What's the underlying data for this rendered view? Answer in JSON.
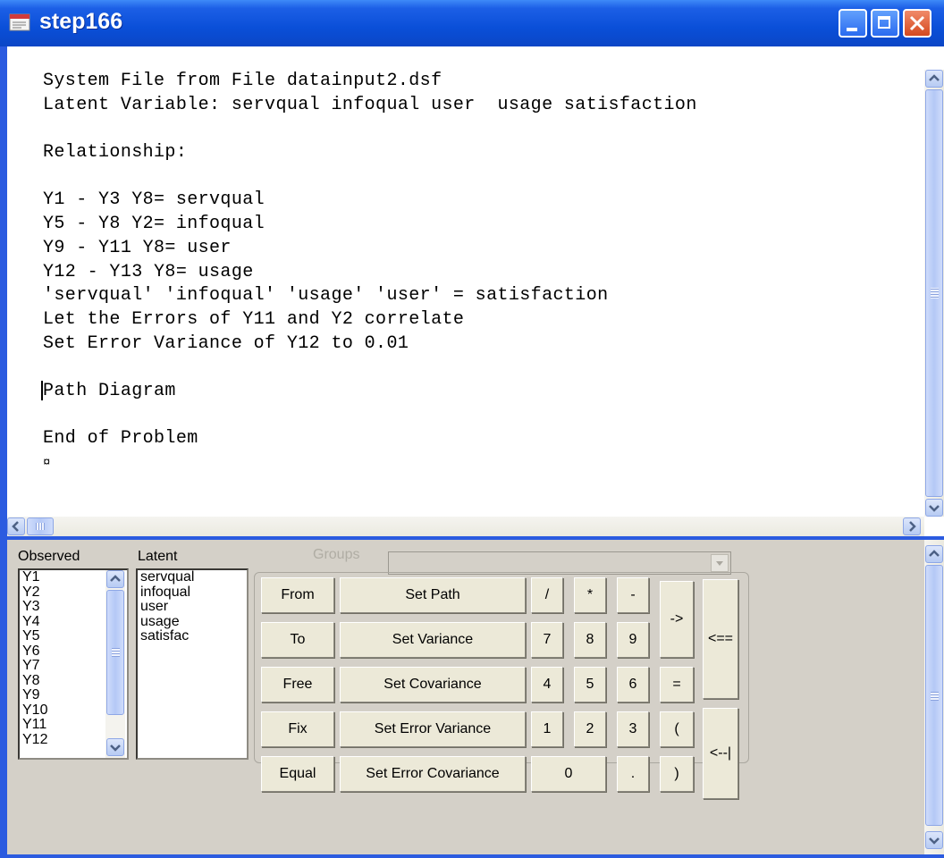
{
  "window": {
    "title": "step166"
  },
  "editor": {
    "lines": [
      "System File from File datainput2.dsf",
      "Latent Variable: servqual infoqual user  usage satisfaction",
      "",
      "Relationship:",
      "",
      "Y1 - Y3 Y8= servqual",
      "Y5 - Y8 Y2= infoqual",
      "Y9 - Y11 Y8= user",
      "Y12 - Y13 Y8= usage",
      "'servqual' 'infoqual' 'usage' 'user' = satisfaction",
      "Let the Errors of Y11 and Y2 correlate",
      "Set Error Variance of Y12 to 0.01",
      "",
      "Path Diagram",
      "",
      "End of Problem",
      "¤"
    ]
  },
  "panel": {
    "observed_label": "Observed",
    "latent_label": "Latent",
    "groups_label": "Groups",
    "observed_items": [
      "Y1",
      "Y2",
      "Y3",
      "Y4",
      "Y5",
      "Y6",
      "Y7",
      "Y8",
      "Y9",
      "Y10",
      "Y11",
      "Y12"
    ],
    "latent_items": [
      "servqual",
      "infoqual",
      "user",
      "usage",
      "satisfac"
    ],
    "buttons": {
      "from": "From",
      "to": "To",
      "free": "Free",
      "fix": "Fix",
      "equal": "Equal",
      "set_path": "Set Path",
      "set_variance": "Set Variance",
      "set_covariance": "Set Covariance",
      "set_error_variance": "Set Error Variance",
      "set_error_covariance": "Set Error Covariance",
      "slash": "/",
      "star": "*",
      "minus": "-",
      "k7": "7",
      "k8": "8",
      "k9": "9",
      "k4": "4",
      "k5": "5",
      "k6": "6",
      "k1": "1",
      "k2": "2",
      "k3": "3",
      "k0": "0",
      "dot": ".",
      "arrow": "->",
      "equals": "=",
      "lparen": "(",
      "rparen": ")",
      "back_arrow": "<==",
      "return_arrow": "<--|"
    }
  },
  "colors": {
    "titlebar": "#0a4fd8",
    "panel": "#d4d0c8",
    "button_face": "#ece9d8"
  }
}
